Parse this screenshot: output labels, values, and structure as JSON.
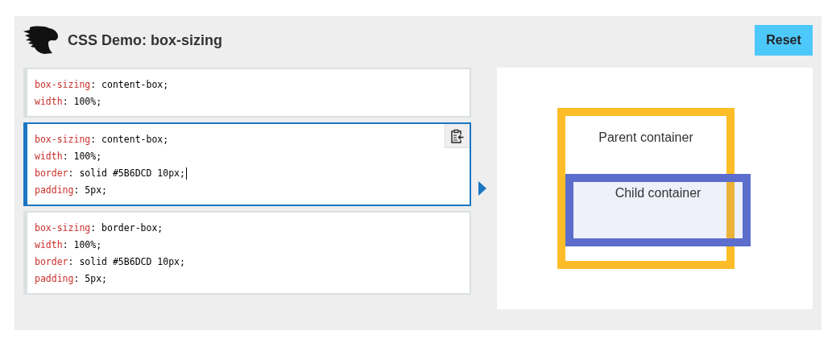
{
  "header": {
    "title": "CSS Demo: box-sizing",
    "reset_button": "Reset"
  },
  "examples": [
    {
      "selected": false,
      "lines": [
        {
          "property": "box-sizing",
          "value": ": content-box;",
          "caret": false
        },
        {
          "property": "width",
          "value": ": 100%;",
          "caret": false
        }
      ]
    },
    {
      "selected": true,
      "lines": [
        {
          "property": "box-sizing",
          "value": ": content-box;",
          "caret": false
        },
        {
          "property": "width",
          "value": ": 100%;",
          "caret": false
        },
        {
          "property": "border",
          "value": ": solid #5B6DCD 10px;",
          "caret": true
        },
        {
          "property": "padding",
          "value": ": 5px;",
          "caret": false
        }
      ]
    },
    {
      "selected": false,
      "lines": [
        {
          "property": "box-sizing",
          "value": ": border-box;",
          "caret": false
        },
        {
          "property": "width",
          "value": ": 100%;",
          "caret": false
        },
        {
          "property": "border",
          "value": ": solid #5B6DCD 10px;",
          "caret": false
        },
        {
          "property": "padding",
          "value": ": 5px;",
          "caret": false
        }
      ]
    }
  ],
  "output": {
    "parent_label": "Parent container",
    "child_label": "Child container"
  }
}
